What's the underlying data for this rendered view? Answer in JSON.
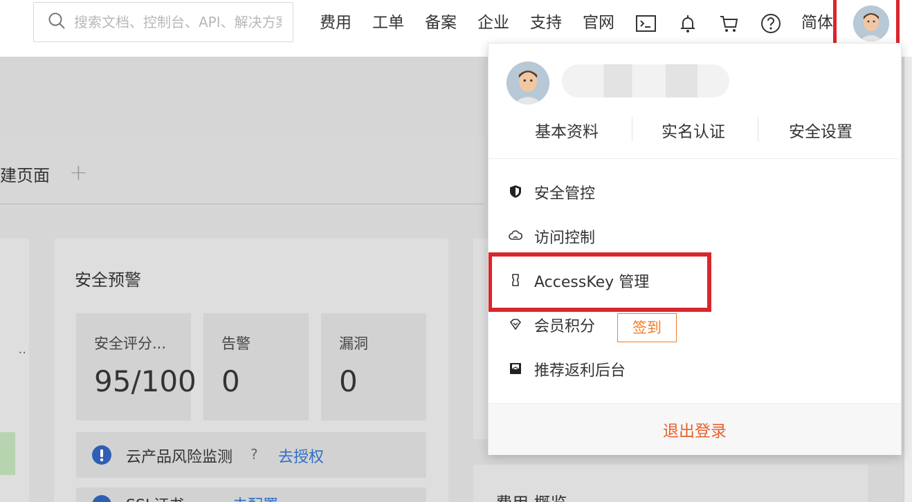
{
  "search": {
    "placeholder": "搜索文档、控制台、API、解决方案和资源"
  },
  "topnav": {
    "items": [
      "费用",
      "工单",
      "备案",
      "企业",
      "支持",
      "官网"
    ],
    "language": "简体"
  },
  "workspace": {
    "tab_label": "建页面",
    "tab_add": "+"
  },
  "security_card": {
    "title": "安全预警",
    "stats": [
      {
        "label": "安全评分...",
        "value": "95/100"
      },
      {
        "label": "告警",
        "value": "0"
      },
      {
        "label": "漏洞",
        "value": "0"
      }
    ],
    "risk_text": "云产品风险监测",
    "risk_help": "?",
    "risk_link": "去授权",
    "ssl_text": "SSL证书",
    "ssl_link": "去配置"
  },
  "cost_card": {
    "title": "费用 概览"
  },
  "account_menu": {
    "profile_links": [
      "基本资料",
      "实名认证",
      "安全设置"
    ],
    "items": [
      {
        "label": "安全管控",
        "icon": "shield-icon"
      },
      {
        "label": "访问控制",
        "icon": "cloud-icon"
      },
      {
        "label": "AccessKey 管理",
        "icon": "key-icon"
      },
      {
        "label": "会员积分",
        "icon": "diamond-icon"
      },
      {
        "label": "推荐返利后台",
        "icon": "wallet-icon"
      }
    ],
    "signin_badge": "签到",
    "logout": "退出登录"
  },
  "colors": {
    "highlight": "#d9262c",
    "accent_orange": "#f57c22",
    "link_blue": "#2d6ec7"
  }
}
